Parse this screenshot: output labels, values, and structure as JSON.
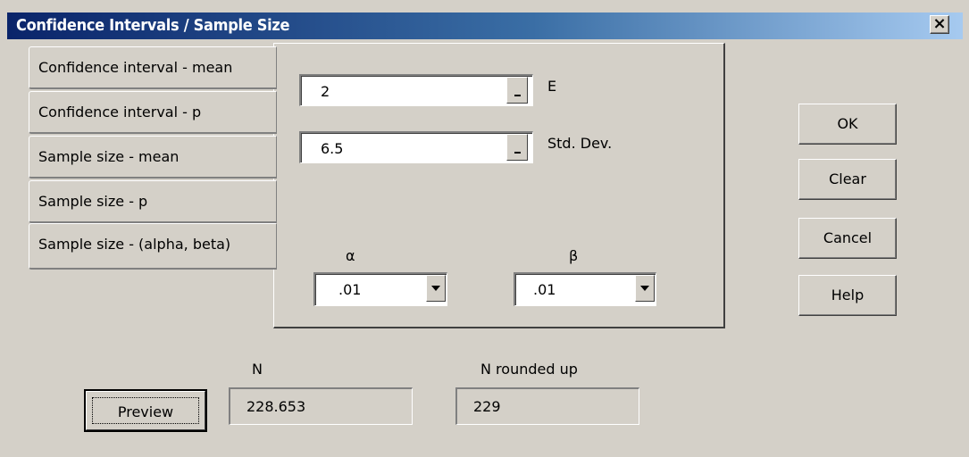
{
  "window": {
    "title": "Confidence Intervals / Sample Size",
    "close": "×"
  },
  "tabs": [
    {
      "label": "Confidence interval - mean"
    },
    {
      "label": "Confidence interval - p"
    },
    {
      "label": "Sample size - mean"
    },
    {
      "label": "Sample size - p"
    },
    {
      "label": "Sample size - (alpha, beta)"
    }
  ],
  "fields": {
    "e": {
      "value": "2",
      "label": "E"
    },
    "std_dev": {
      "value": "6.5",
      "label": "Std. Dev."
    },
    "alpha": {
      "label": "α",
      "selected": ".01"
    },
    "beta": {
      "label": "β",
      "selected": ".01"
    }
  },
  "buttons": {
    "ok": "OK",
    "clear": "Clear",
    "cancel": "Cancel",
    "help": "Help",
    "preview": "Preview"
  },
  "results": {
    "n": {
      "label": "N",
      "value": "228.653"
    },
    "n_rounded": {
      "label": "N rounded up",
      "value": "229"
    }
  }
}
